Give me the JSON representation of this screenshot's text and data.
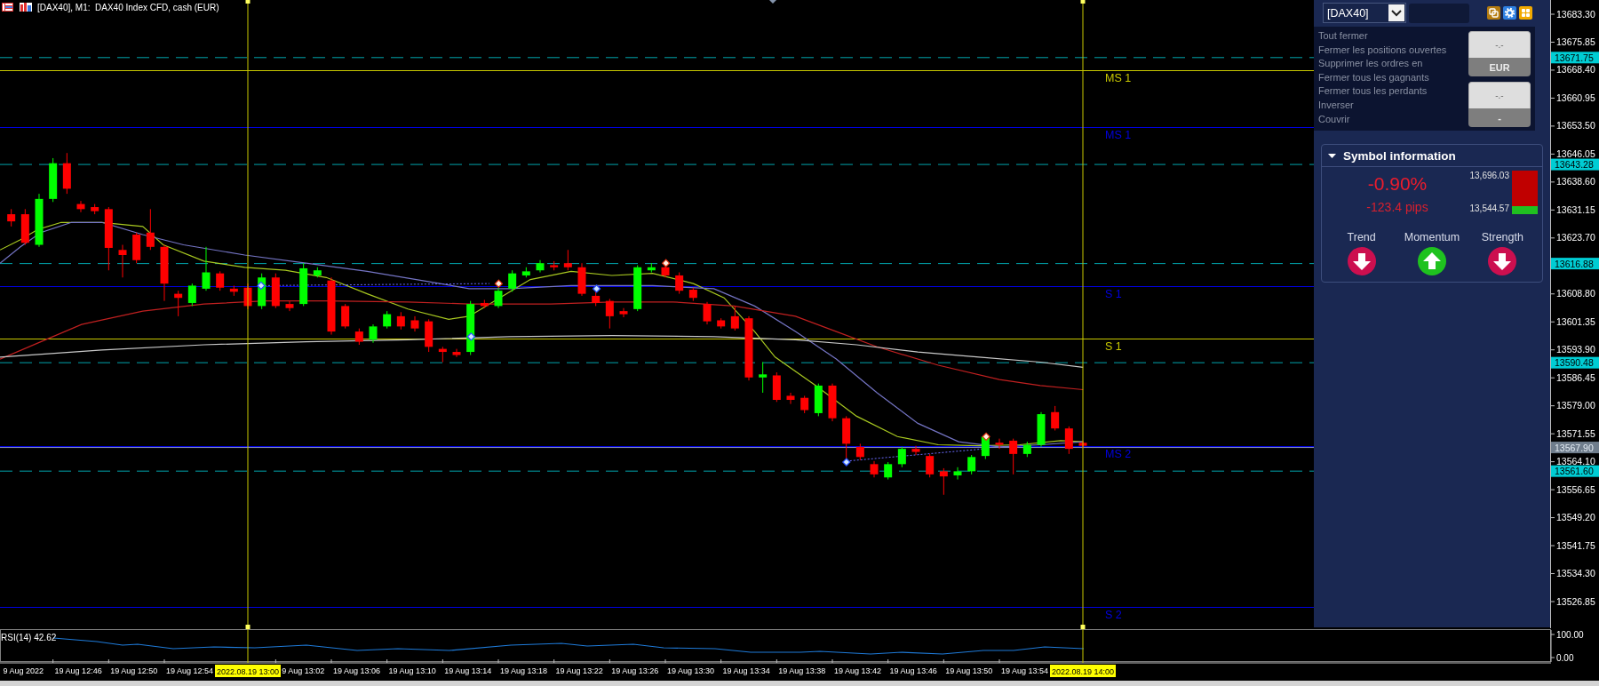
{
  "window": {
    "title": "[DAX40], M1:  DAX40 Index CFD, cash (EUR)"
  },
  "chart": {
    "price_labels": [
      "13683.30",
      "13675.85",
      "13668.40",
      "13660.95",
      "13653.50",
      "13646.05",
      "13638.60",
      "13631.15",
      "13623.70",
      "13608.80",
      "13601.35",
      "13593.90",
      "13586.45",
      "13579.00",
      "13571.55",
      "13564.10",
      "13556.65",
      "13549.20",
      "13541.75",
      "13534.30",
      "13526.85"
    ],
    "marked_prices": [
      {
        "value": "13671.75",
        "kind": "level"
      },
      {
        "value": "13643.28",
        "kind": "level"
      },
      {
        "value": "13616.88",
        "kind": "level"
      },
      {
        "value": "13590.48",
        "kind": "level"
      },
      {
        "value": "13567.90",
        "kind": "bid"
      },
      {
        "value": "13561.60",
        "kind": "level"
      }
    ],
    "pivot_lines": [
      {
        "label": "MS 1",
        "color": "#c8c800"
      },
      {
        "label": "MS 1",
        "color": "#0000e0"
      },
      {
        "label": "S 1",
        "color": "#0000e0"
      },
      {
        "label": "S 1",
        "color": "#c8c800"
      },
      {
        "label": "MS 2",
        "color": "#0000e0"
      },
      {
        "label": "S 2",
        "color": "#0000e0"
      }
    ],
    "time_markers": [
      "2022.08.19 13:00",
      "2022.08.19 14:00"
    ],
    "time_labels": [
      "9 Aug 2022",
      "19 Aug 12:46",
      "19 Aug 12:50",
      "19 Aug 12:54",
      "9 Aug 13:02",
      "19 Aug 13:06",
      "19 Aug 13:10",
      "19 Aug 13:14",
      "19 Aug 13:18",
      "19 Aug 13:22",
      "19 Aug 13:26",
      "19 Aug 13:30",
      "19 Aug 13:34",
      "19 Aug 13:38",
      "19 Aug 13:42",
      "19 Aug 13:46",
      "19 Aug 13:50",
      "19 Aug 13:54"
    ]
  },
  "indicator": {
    "label": "RSI(14) 42.62",
    "scale_labels": [
      "100.00",
      "0.00"
    ]
  },
  "panel": {
    "symbol": "[DAX40]",
    "actions": [
      "Tout fermer",
      "Fermer les positions ouvertes",
      "Supprimer les ordres en",
      "Fermer tous les gagnants",
      "Fermer tous les perdants",
      "Inverser",
      "Couvrir"
    ],
    "value_boxes": [
      {
        "value": "-.-",
        "unit": "EUR"
      },
      {
        "value": "-.-",
        "unit": "-"
      }
    ],
    "symbol_info": {
      "title": "Symbol information",
      "expanded": true,
      "change_percent": "-0.90%",
      "change_pips": "-123.4 pips",
      "high": "13,696.03",
      "low": "13,544.57",
      "level": 0.18,
      "signals": [
        {
          "label": "Trend",
          "up": false
        },
        {
          "label": "Momentum",
          "up": true
        },
        {
          "label": "Strength",
          "up": false
        }
      ]
    }
  }
}
